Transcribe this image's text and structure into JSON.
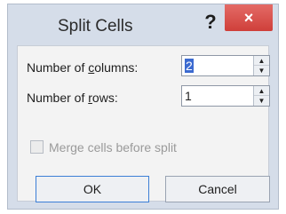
{
  "dialog": {
    "title": "Split Cells",
    "help_label": "?",
    "close_label": "×"
  },
  "fields": {
    "columns": {
      "label_pre": "Number of ",
      "label_accel": "c",
      "label_post": "olumns:",
      "value": "2"
    },
    "rows": {
      "label_pre": "Number of ",
      "label_accel": "r",
      "label_post": "ows:",
      "value": "1"
    }
  },
  "merge_checkbox": {
    "label": "Merge cells before split",
    "checked": false,
    "disabled": true
  },
  "buttons": {
    "ok": "OK",
    "cancel": "Cancel"
  },
  "icons": {
    "spin_up": "▲",
    "spin_down": "▼"
  },
  "colors": {
    "close_button": "#d9534f",
    "selection": "#3b6ad0",
    "dialog_frame": "#d5dde9"
  }
}
